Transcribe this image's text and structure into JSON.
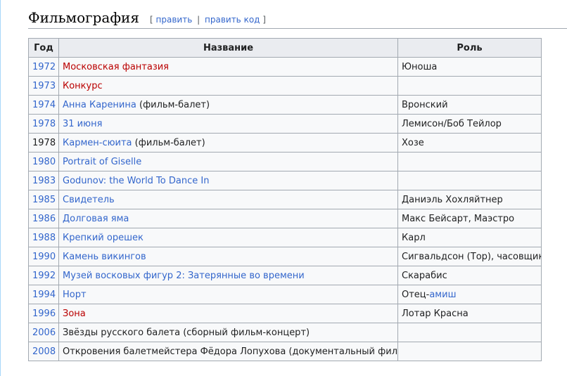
{
  "section": {
    "title": "Фильмография",
    "edit_open": "[",
    "edit_label": "править",
    "edit_sep": "|",
    "edit_code_label": "править код",
    "edit_close": "]"
  },
  "table": {
    "headers": [
      "Год",
      "Название",
      "Роль"
    ],
    "rows": [
      {
        "year": "1972",
        "year_link": true,
        "title": "Московская фантазия",
        "title_kind": "redlink",
        "suffix": "",
        "role": "Юноша",
        "role_link": ""
      },
      {
        "year": "1973",
        "year_link": true,
        "title": "Конкурс",
        "title_kind": "redlink",
        "suffix": "",
        "role": "",
        "role_link": ""
      },
      {
        "year": "1974",
        "year_link": true,
        "title": "Анна Каренина",
        "title_kind": "link",
        "suffix": " (фильм-балет)",
        "role": "Вронский",
        "role_link": ""
      },
      {
        "year": "1978",
        "year_link": true,
        "title": "31 июня",
        "title_kind": "link",
        "suffix": "",
        "role": "Лемисон/Боб Тейлор",
        "role_link": ""
      },
      {
        "year": "1978",
        "year_link": false,
        "title": "Кармен-сюита",
        "title_kind": "link",
        "suffix": " (фильм-балет)",
        "role": "Хозе",
        "role_link": ""
      },
      {
        "year": "1980",
        "year_link": true,
        "title": "Portrait of Giselle",
        "title_kind": "extlink",
        "suffix": "",
        "role": "",
        "role_link": ""
      },
      {
        "year": "1983",
        "year_link": true,
        "title": "Godunov: the World To Dance In",
        "title_kind": "extlink",
        "suffix": "",
        "role": "",
        "role_link": ""
      },
      {
        "year": "1985",
        "year_link": true,
        "title": "Свидетель",
        "title_kind": "link",
        "suffix": "",
        "role": "Даниэль Хохляйтнер",
        "role_link": ""
      },
      {
        "year": "1986",
        "year_link": true,
        "title": "Долговая яма",
        "title_kind": "link",
        "suffix": "",
        "role": "Макс Бейсарт, Маэстро",
        "role_link": ""
      },
      {
        "year": "1988",
        "year_link": true,
        "title": "Крепкий орешек",
        "title_kind": "link",
        "suffix": "",
        "role": "Карл",
        "role_link": ""
      },
      {
        "year": "1990",
        "year_link": true,
        "title": "Камень викингов",
        "title_kind": "link",
        "suffix": "",
        "role": "Сигвальдсон (Тор), часовщик",
        "role_link": ""
      },
      {
        "year": "1992",
        "year_link": true,
        "title": "Музей восковых фигур 2: Затерянные во времени",
        "title_kind": "link",
        "suffix": "",
        "role": "Скарабис",
        "role_link": ""
      },
      {
        "year": "1994",
        "year_link": true,
        "title": "Норт",
        "title_kind": "link",
        "suffix": "",
        "role": "Отец-",
        "role_link": "амиш"
      },
      {
        "year": "1996",
        "year_link": true,
        "title": "Зона",
        "title_kind": "redlink",
        "suffix": "",
        "role": "Лотар Красна",
        "role_link": ""
      },
      {
        "year": "2006",
        "year_link": true,
        "title": "Звёзды русского балета (сборный фильм-концерт)",
        "title_kind": "plain",
        "suffix": "",
        "role": "",
        "role_link": ""
      },
      {
        "year": "2008",
        "year_link": true,
        "title": "Откровения балетмейстера Фёдора Лопухова (документальный фильм)",
        "title_kind": "plain",
        "suffix": "",
        "role": "",
        "role_link": ""
      }
    ]
  },
  "colors": {
    "link": "#3366cc",
    "redlink": "#ba0000",
    "border": "#a2a9b1",
    "header_bg": "#eaecf0",
    "cell_bg": "#f8f9fa"
  }
}
